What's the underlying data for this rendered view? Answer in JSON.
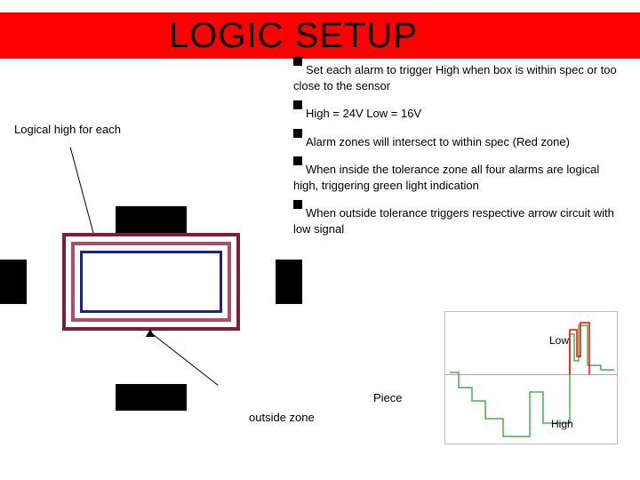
{
  "title": "LOGIC SETUP",
  "bullets": [
    "Set each alarm to trigger High when box is within spec or too close to the sensor",
    "High = 24V Low = 16V",
    "Alarm zones will intersect to within spec (Red zone)",
    "When inside the tolerance zone all four alarms are logical high, triggering green light indication",
    "When outside tolerance triggers respective arrow circuit with low signal"
  ],
  "labels": {
    "logical_high": "Logical high for each",
    "outside_zone": "outside zone",
    "piece": "Piece",
    "low": "Low",
    "high": "High"
  }
}
